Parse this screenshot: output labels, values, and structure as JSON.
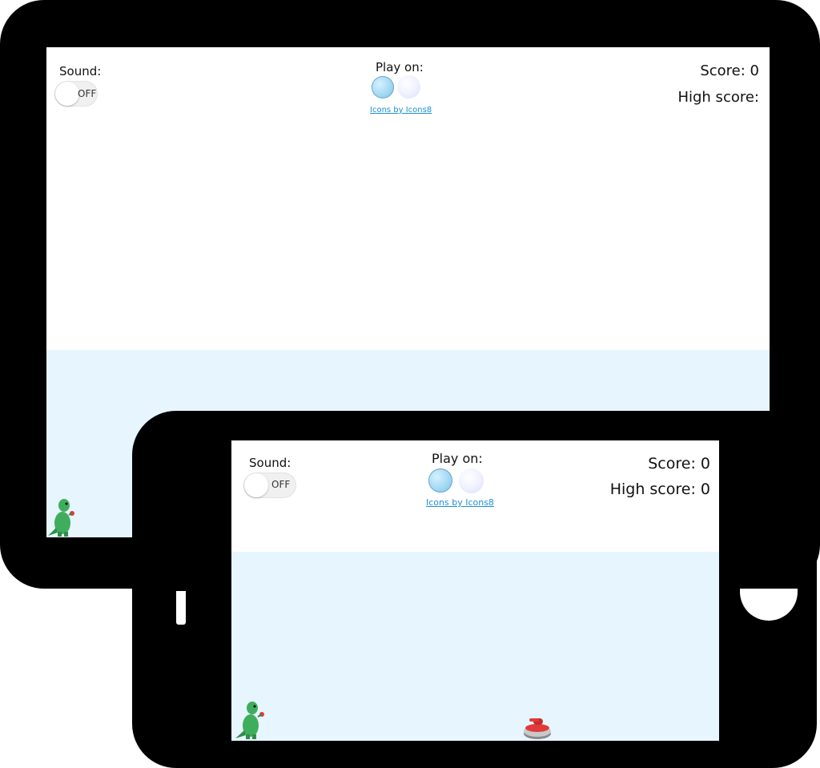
{
  "tablet": {
    "sound": {
      "label": "Sound:",
      "toggle_text": "OFF"
    },
    "play_on": {
      "label": "Play on:",
      "icons": [
        "earth-icon",
        "moon-icon"
      ],
      "credit": "Icons by Icons8"
    },
    "score": {
      "score_text": "Score: 0",
      "high_score_text": "High score:"
    }
  },
  "phone": {
    "sound": {
      "label": "Sound:",
      "toggle_text": "OFF"
    },
    "play_on": {
      "label": "Play on:",
      "icons": [
        "earth-icon",
        "moon-icon"
      ],
      "credit": "Icons by Icons8"
    },
    "score": {
      "score_text": "Score: 0",
      "high_score_text": "High score: 0"
    }
  },
  "colors": {
    "ice": "#e6f5fe",
    "link": "#1e8fd6",
    "frame": "#000000",
    "dino_green": "#3fae5c",
    "stone_red": "#e03a3a"
  }
}
